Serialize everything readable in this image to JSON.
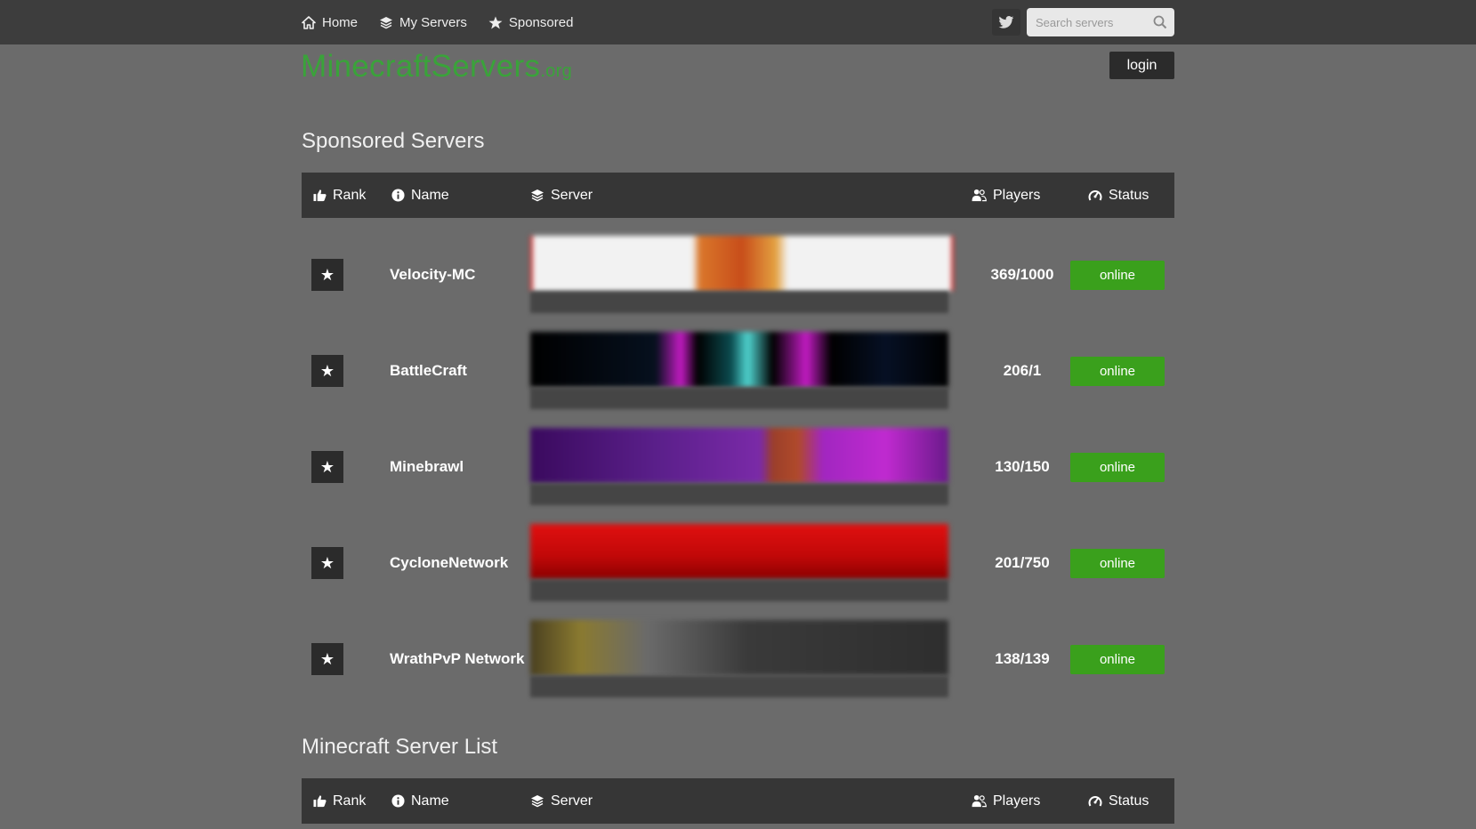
{
  "nav": {
    "items": [
      {
        "label": "Home",
        "icon": "home-icon"
      },
      {
        "label": "My Servers",
        "icon": "layers-icon"
      },
      {
        "label": "Sponsored",
        "icon": "star-icon"
      }
    ],
    "search_placeholder": "Search servers"
  },
  "brand": {
    "name": "MinecraftServers",
    "tld": ".org",
    "color": "#3aa33a"
  },
  "login_label": "login",
  "sponsored": {
    "title": "Sponsored Servers",
    "headers": {
      "rank": "Rank",
      "name": "Name",
      "server": "Server",
      "players": "Players",
      "status": "Status"
    },
    "rows": [
      {
        "name": "Velocity-MC",
        "players": "369/1000",
        "status": "online"
      },
      {
        "name": "BattleCraft",
        "players": "206/1",
        "status": "online"
      },
      {
        "name": "Minebrawl",
        "players": "130/150",
        "status": "online"
      },
      {
        "name": "CycloneNetwork",
        "players": "201/750",
        "status": "online"
      },
      {
        "name": "WrathPvP Network",
        "players": "138/139",
        "status": "online"
      }
    ]
  },
  "list": {
    "title": "Minecraft Server List",
    "headers": {
      "rank": "Rank",
      "name": "Name",
      "server": "Server",
      "players": "Players",
      "status": "Status"
    }
  },
  "colors": {
    "online": "#3aa01c",
    "topbar": "#3d3d3d",
    "background": "#6b6b6b"
  }
}
